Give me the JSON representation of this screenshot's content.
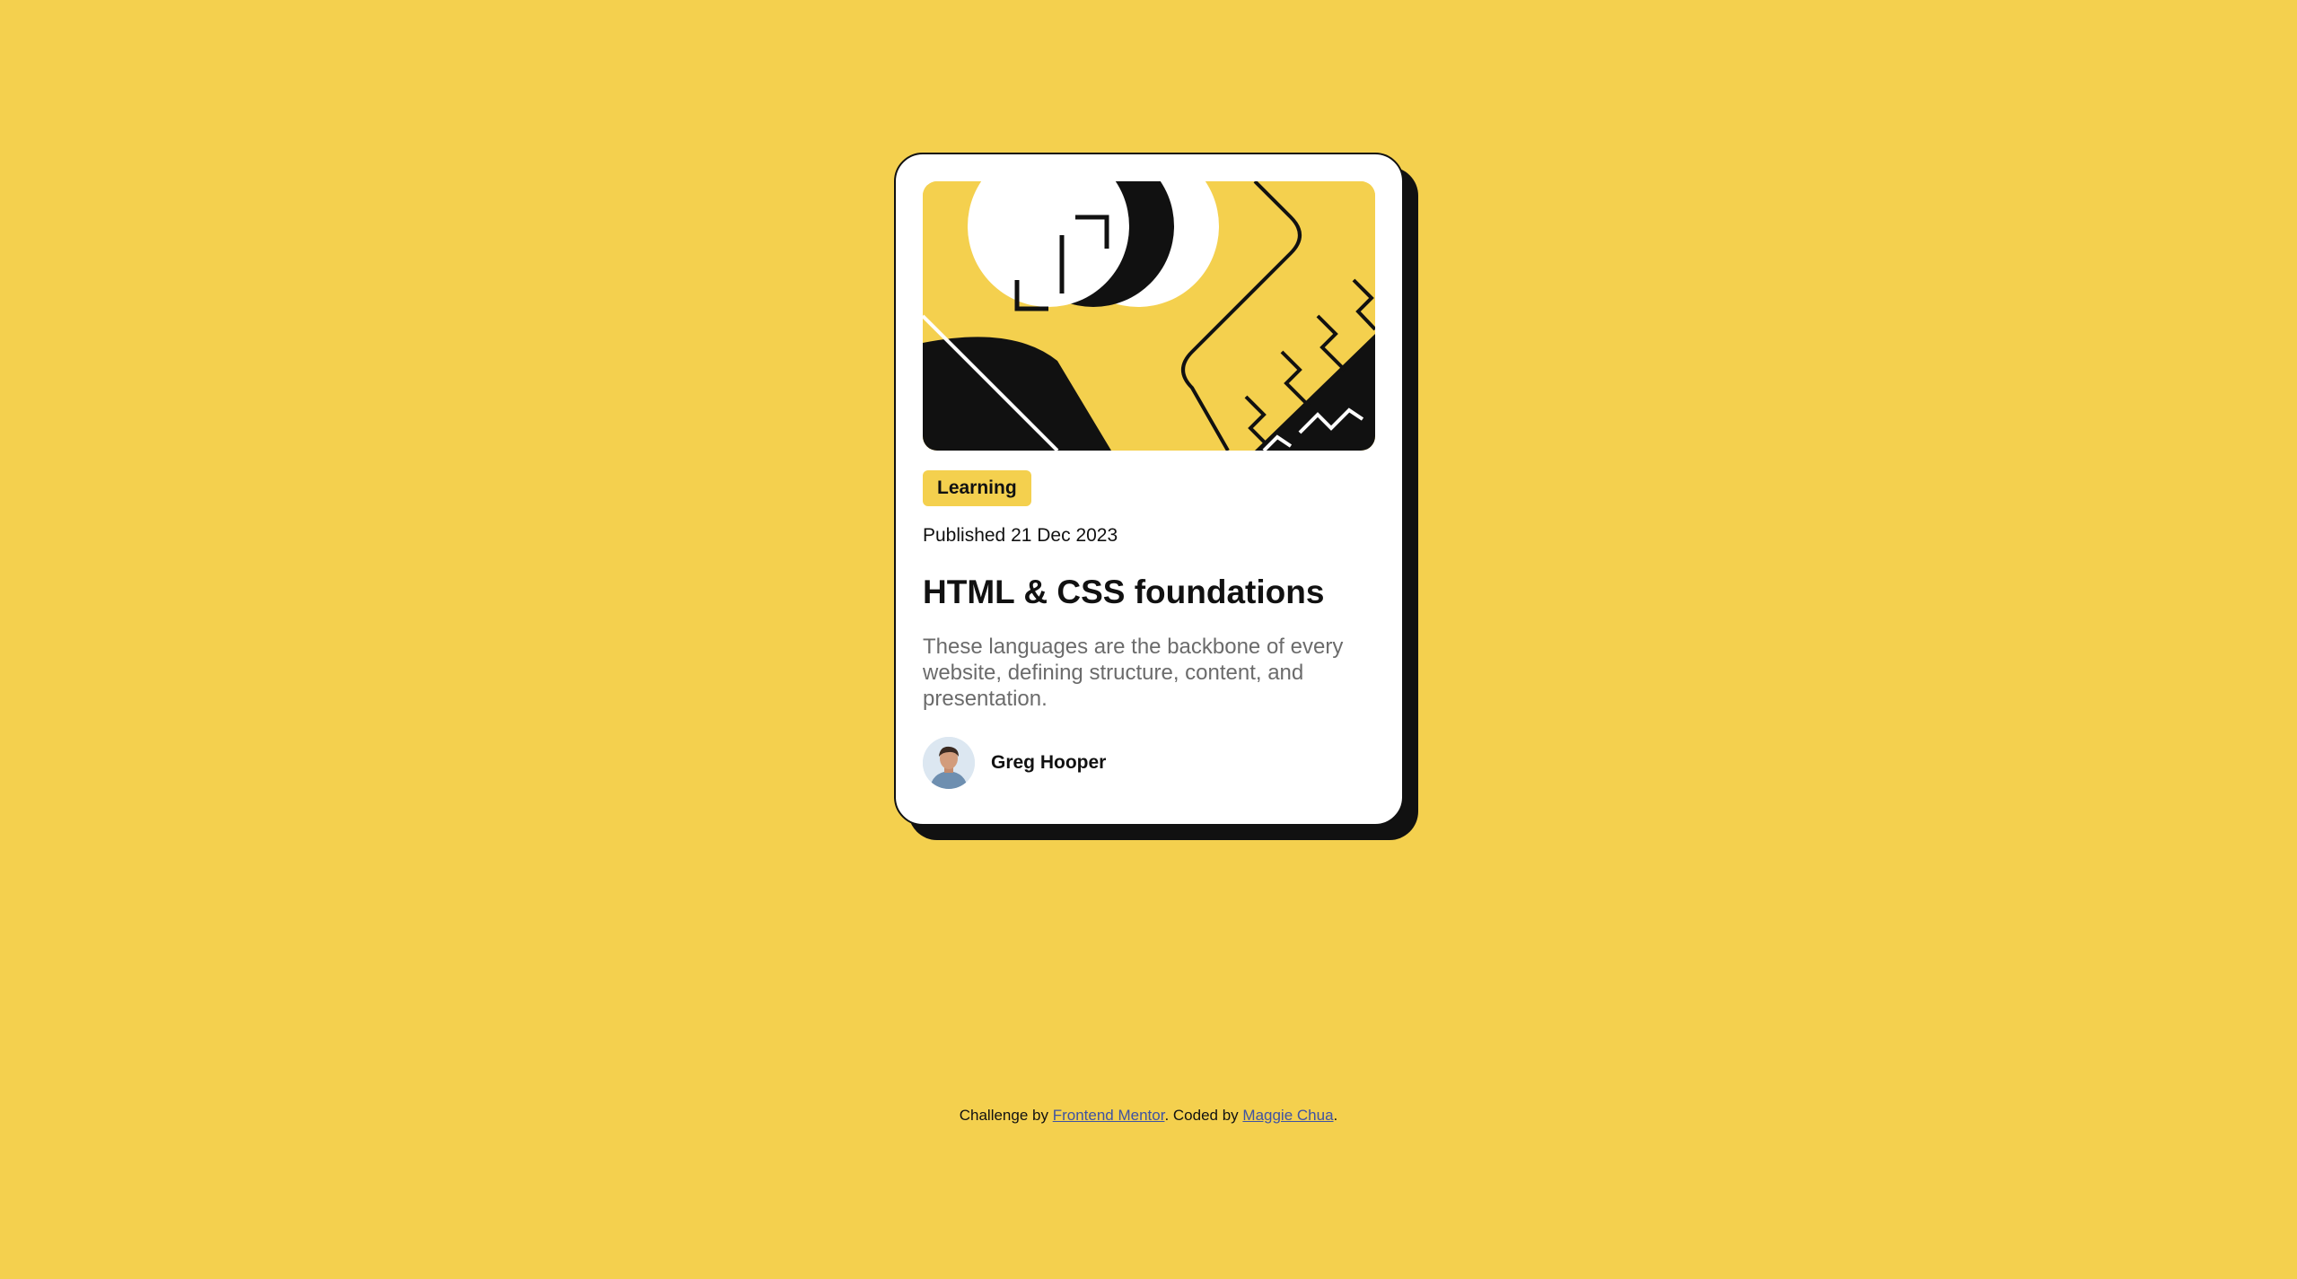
{
  "card": {
    "tag": "Learning",
    "published": "Published 21 Dec 2023",
    "title": "HTML & CSS foundations",
    "description": "These languages are the backbone of every website, defining structure, content, and presentation.",
    "author": {
      "name": "Greg Hooper",
      "avatar_icon": "user-avatar"
    },
    "illustration_icon": "abstract-illustration"
  },
  "attribution": {
    "prefix": "Challenge by ",
    "link1": "Frontend Mentor",
    "middle": ". Coded by ",
    "link2": "Maggie Chua",
    "suffix": "."
  },
  "colors": {
    "background": "#F4D04E",
    "card": "#FFFFFF",
    "ink": "#111111",
    "muted": "#6B6B6B",
    "link": "#3E52A3"
  }
}
